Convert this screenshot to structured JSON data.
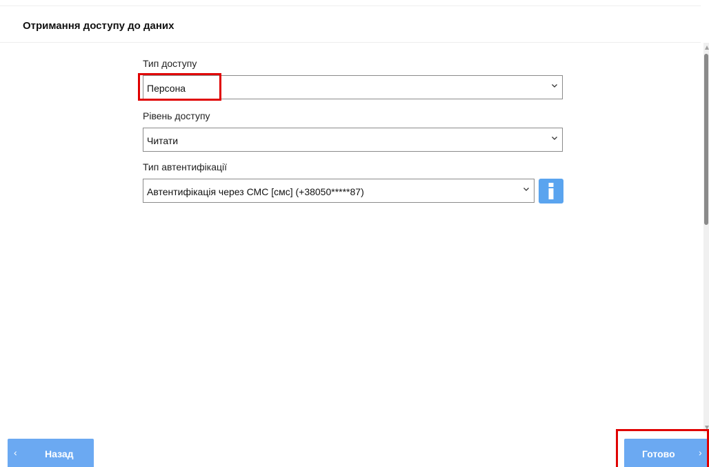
{
  "header": {
    "title": "Отримання доступу до даних"
  },
  "form": {
    "access_type": {
      "label": "Тип доступу",
      "value": "Персона"
    },
    "access_level": {
      "label": "Рівень доступу",
      "value": "Читати"
    },
    "auth_type": {
      "label": "Тип автентифікації",
      "value": "Автентифікація через СМС [смс] (+38050*****87)"
    },
    "info_icon": "info-icon"
  },
  "footer": {
    "back_label": "Назад",
    "back_icon": "chevron-left-icon",
    "done_label": "Готово",
    "done_icon": "chevron-right-icon"
  },
  "colors": {
    "button": "#6ba9f2",
    "info_button": "#5aa4ef",
    "highlight": "#e00000"
  }
}
